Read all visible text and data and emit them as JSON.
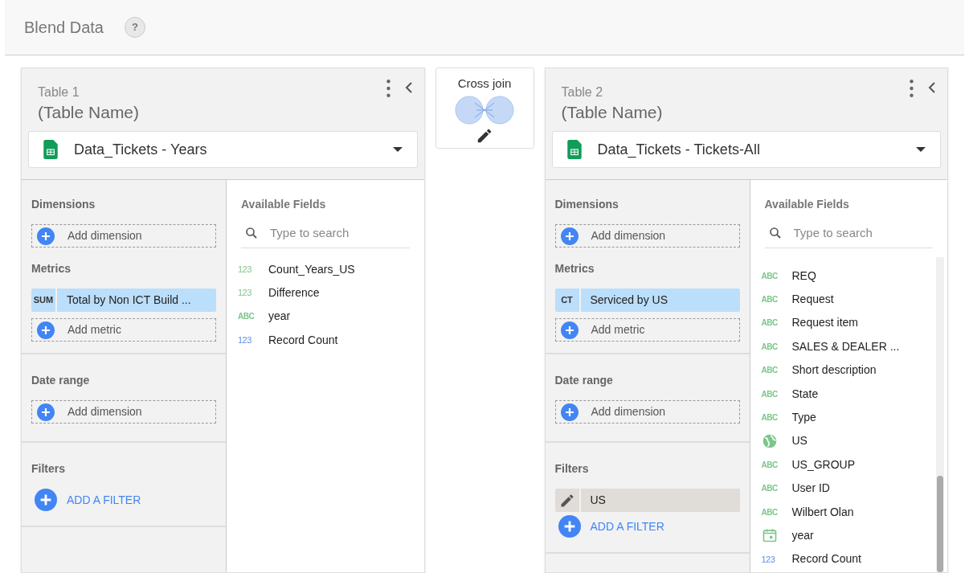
{
  "header": {
    "title": "Blend Data",
    "help": "?"
  },
  "join": {
    "label": "Cross join"
  },
  "tables": [
    {
      "label": "Table 1",
      "name": "(Table Name)",
      "source": "Data_Tickets - Years",
      "dimensions": {
        "title": "Dimensions",
        "add": "Add dimension"
      },
      "metrics": {
        "title": "Metrics",
        "items": [
          {
            "badge": "SUM",
            "label": "Total by Non ICT Build ..."
          }
        ],
        "add": "Add metric"
      },
      "date_range": {
        "title": "Date range",
        "add": "Add dimension"
      },
      "filters": {
        "title": "Filters",
        "add": "ADD A FILTER"
      },
      "fields_title": "Available Fields",
      "search_placeholder": "Type to search",
      "scrollable": false,
      "fields": [
        {
          "kind": "number",
          "type": "123",
          "label": "Count_Years_US"
        },
        {
          "kind": "number",
          "type": "123",
          "label": "Difference"
        },
        {
          "kind": "text",
          "type": "ABC",
          "label": "year"
        },
        {
          "kind": "count",
          "type": "123",
          "label": "Record Count"
        }
      ]
    },
    {
      "label": "Table 2",
      "name": "(Table Name)",
      "source": "Data_Tickets - Tickets-All",
      "dimensions": {
        "title": "Dimensions",
        "add": "Add dimension"
      },
      "metrics": {
        "title": "Metrics",
        "items": [
          {
            "badge": "CT",
            "label": "Serviced by US"
          }
        ],
        "add": "Add metric"
      },
      "date_range": {
        "title": "Date range",
        "add": "Add dimension"
      },
      "filters": {
        "title": "Filters",
        "items": [
          {
            "label": "US"
          }
        ],
        "add": "ADD A FILTER"
      },
      "fields_title": "Available Fields",
      "search_placeholder": "Type to search",
      "scrollable": true,
      "fields": [
        {
          "kind": "text",
          "type": "ABC",
          "label": "REQ"
        },
        {
          "kind": "text",
          "type": "ABC",
          "label": "Request"
        },
        {
          "kind": "text",
          "type": "ABC",
          "label": "Request item"
        },
        {
          "kind": "text",
          "type": "ABC",
          "label": "SALES & DEALER ..."
        },
        {
          "kind": "text",
          "type": "ABC",
          "label": "Short description"
        },
        {
          "kind": "text",
          "type": "ABC",
          "label": "State"
        },
        {
          "kind": "text",
          "type": "ABC",
          "label": "Type"
        },
        {
          "kind": "geo",
          "label": "US"
        },
        {
          "kind": "text",
          "type": "ABC",
          "label": "US_GROUP"
        },
        {
          "kind": "text",
          "type": "ABC",
          "label": "User ID"
        },
        {
          "kind": "text",
          "type": "ABC",
          "label": "Wilbert Olan"
        },
        {
          "kind": "date",
          "label": "year"
        },
        {
          "kind": "count",
          "type": "123",
          "label": "Record Count"
        }
      ]
    }
  ]
}
